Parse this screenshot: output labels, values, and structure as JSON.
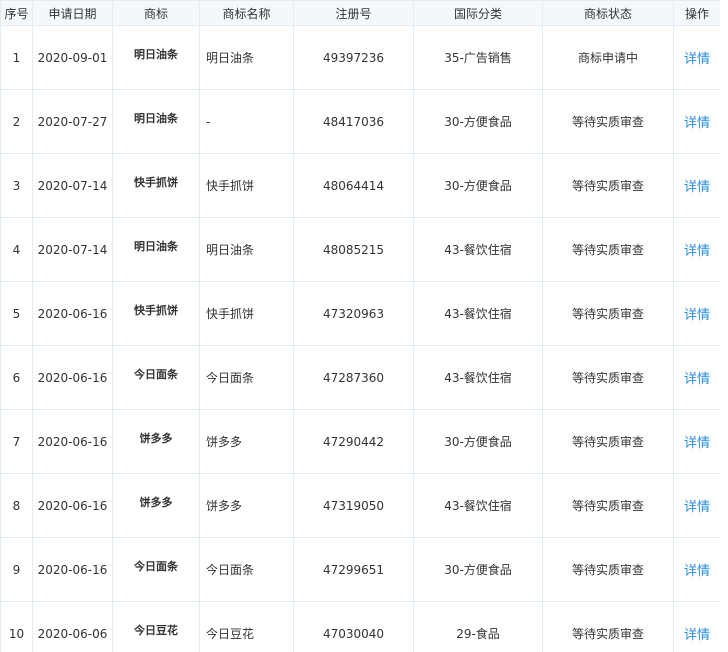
{
  "headers": {
    "index": "序号",
    "date": "申请日期",
    "mark": "商标",
    "name": "商标名称",
    "reg_no": "注册号",
    "class": "国际分类",
    "status": "商标状态",
    "action": "操作"
  },
  "rows": [
    {
      "index": "1",
      "date": "2020-09-01",
      "mark": "明日油条",
      "name": "明日油条",
      "reg_no": "49397236",
      "class": "35-广告销售",
      "status": "商标申请中",
      "action": "详情"
    },
    {
      "index": "2",
      "date": "2020-07-27",
      "mark": "明日油条",
      "name": "-",
      "reg_no": "48417036",
      "class": "30-方便食品",
      "status": "等待实质审查",
      "action": "详情"
    },
    {
      "index": "3",
      "date": "2020-07-14",
      "mark": "快手抓饼",
      "name": "快手抓饼",
      "reg_no": "48064414",
      "class": "30-方便食品",
      "status": "等待实质审查",
      "action": "详情"
    },
    {
      "index": "4",
      "date": "2020-07-14",
      "mark": "明日油条",
      "name": "明日油条",
      "reg_no": "48085215",
      "class": "43-餐饮住宿",
      "status": "等待实质审查",
      "action": "详情"
    },
    {
      "index": "5",
      "date": "2020-06-16",
      "mark": "快手抓饼",
      "name": "快手抓饼",
      "reg_no": "47320963",
      "class": "43-餐饮住宿",
      "status": "等待实质审查",
      "action": "详情"
    },
    {
      "index": "6",
      "date": "2020-06-16",
      "mark": "今日面条",
      "name": "今日面条",
      "reg_no": "47287360",
      "class": "43-餐饮住宿",
      "status": "等待实质审查",
      "action": "详情"
    },
    {
      "index": "7",
      "date": "2020-06-16",
      "mark": "饼多多",
      "name": "饼多多",
      "reg_no": "47290442",
      "class": "30-方便食品",
      "status": "等待实质审查",
      "action": "详情"
    },
    {
      "index": "8",
      "date": "2020-06-16",
      "mark": "饼多多",
      "name": "饼多多",
      "reg_no": "47319050",
      "class": "43-餐饮住宿",
      "status": "等待实质审查",
      "action": "详情"
    },
    {
      "index": "9",
      "date": "2020-06-16",
      "mark": "今日面条",
      "name": "今日面条",
      "reg_no": "47299651",
      "class": "30-方便食品",
      "status": "等待实质审查",
      "action": "详情"
    },
    {
      "index": "10",
      "date": "2020-06-06",
      "mark": "今日豆花",
      "name": "今日豆花",
      "reg_no": "47030040",
      "class": "29-食品",
      "status": "等待实质审查",
      "action": "详情"
    }
  ],
  "colors": {
    "header_bg": "#f4f8fb",
    "border": "#e4ecf3",
    "link": "#2a8ee5",
    "text": "#333333"
  }
}
